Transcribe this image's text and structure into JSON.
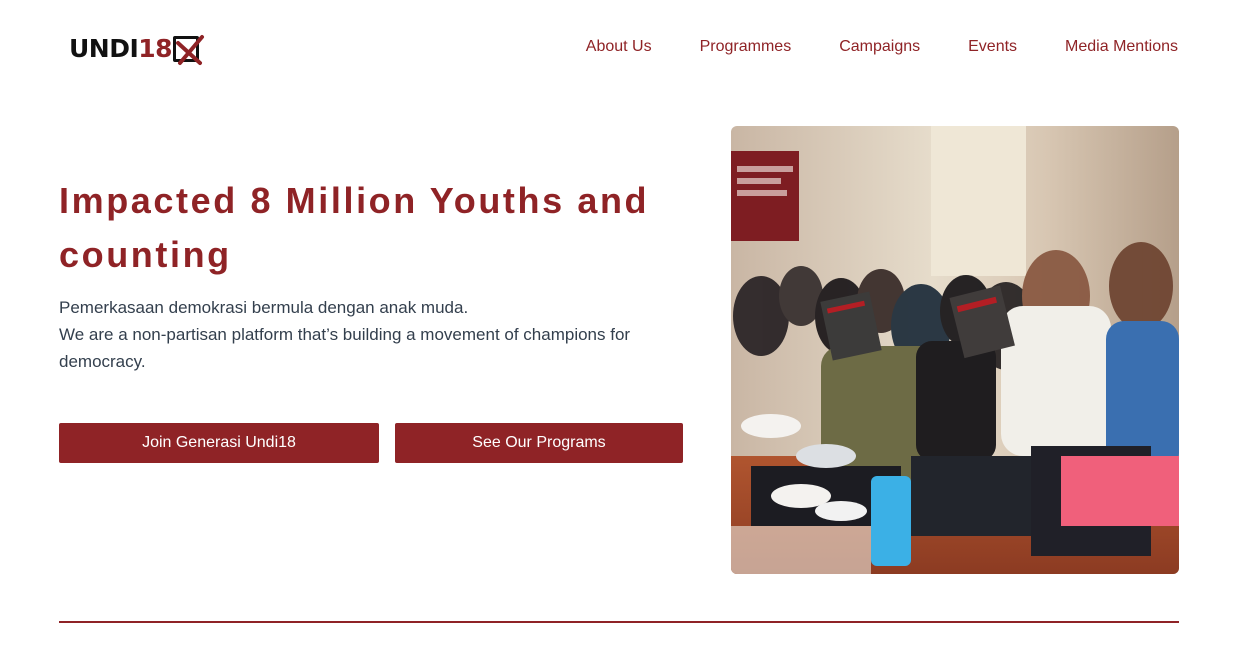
{
  "brand": {
    "logo_text_primary": "UNDI",
    "logo_text_number": "18",
    "logo_alt": "UNDI18",
    "accent_color": "#8f2326"
  },
  "nav": {
    "items": [
      {
        "label": "About Us"
      },
      {
        "label": "Programmes"
      },
      {
        "label": "Campaigns"
      },
      {
        "label": "Events"
      },
      {
        "label": "Media Mentions"
      }
    ]
  },
  "hero": {
    "title": "Impacted 8 Million Youths and counting",
    "line1": "Pemerkasaan demokrasi bermula dengan anak muda.",
    "line2": "We are a non-partisan platform that’s building a movement of champions for democracy.",
    "primary_button": "Join Generasi Undi18",
    "secondary_button": "See Our Programs"
  },
  "photo": {
    "description_icon": "event-audience-photo",
    "banner_text": "DEMOKRASI DENGAR"
  }
}
